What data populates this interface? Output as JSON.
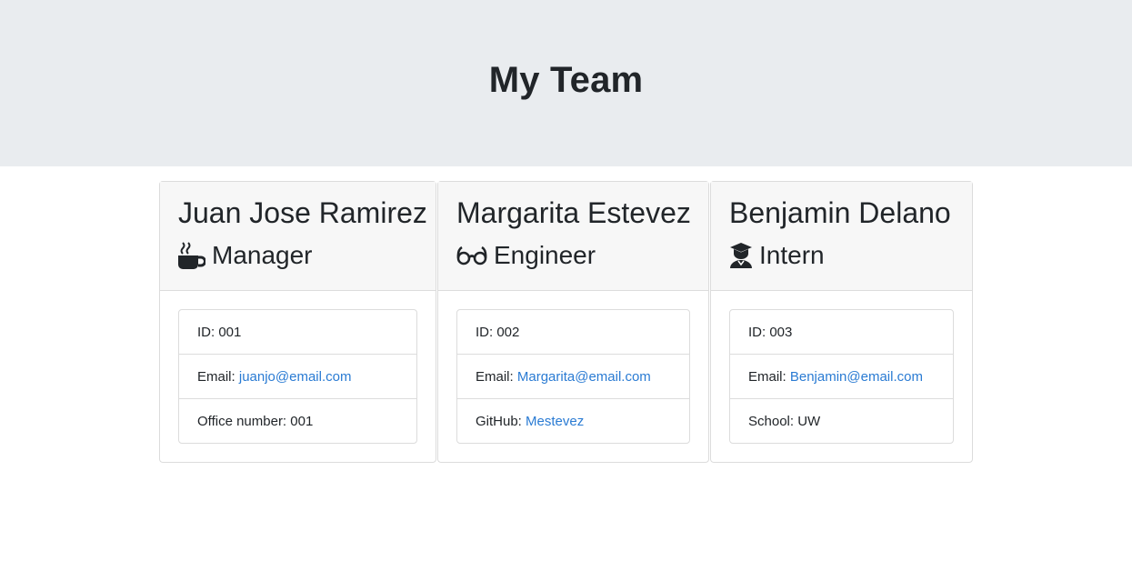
{
  "page": {
    "title": "My Team"
  },
  "team": [
    {
      "name": "Juan Jose Ramirez",
      "role": "Manager",
      "role_icon": "coffee-mug-icon",
      "id_label": "ID: 001",
      "email_prefix": "Email: ",
      "email": "juanjo@email.com",
      "extra_prefix": "Office number: 001",
      "extra_link": ""
    },
    {
      "name": "Margarita Estevez",
      "role": "Engineer",
      "role_icon": "glasses-icon",
      "id_label": "ID: 002",
      "email_prefix": "Email: ",
      "email": "Margarita@email.com",
      "extra_prefix": "GitHub: ",
      "extra_link": "Mestevez"
    },
    {
      "name": "Benjamin Delano",
      "role": "Intern",
      "role_icon": "graduate-icon",
      "id_label": "ID: 003",
      "email_prefix": "Email: ",
      "email": "Benjamin@email.com",
      "extra_prefix": "School: UW",
      "extra_link": ""
    }
  ],
  "colors": {
    "header_bg": "#e9ecef",
    "card_header_bg": "#f7f7f7",
    "link": "#2a7bd3",
    "text": "#212529"
  }
}
